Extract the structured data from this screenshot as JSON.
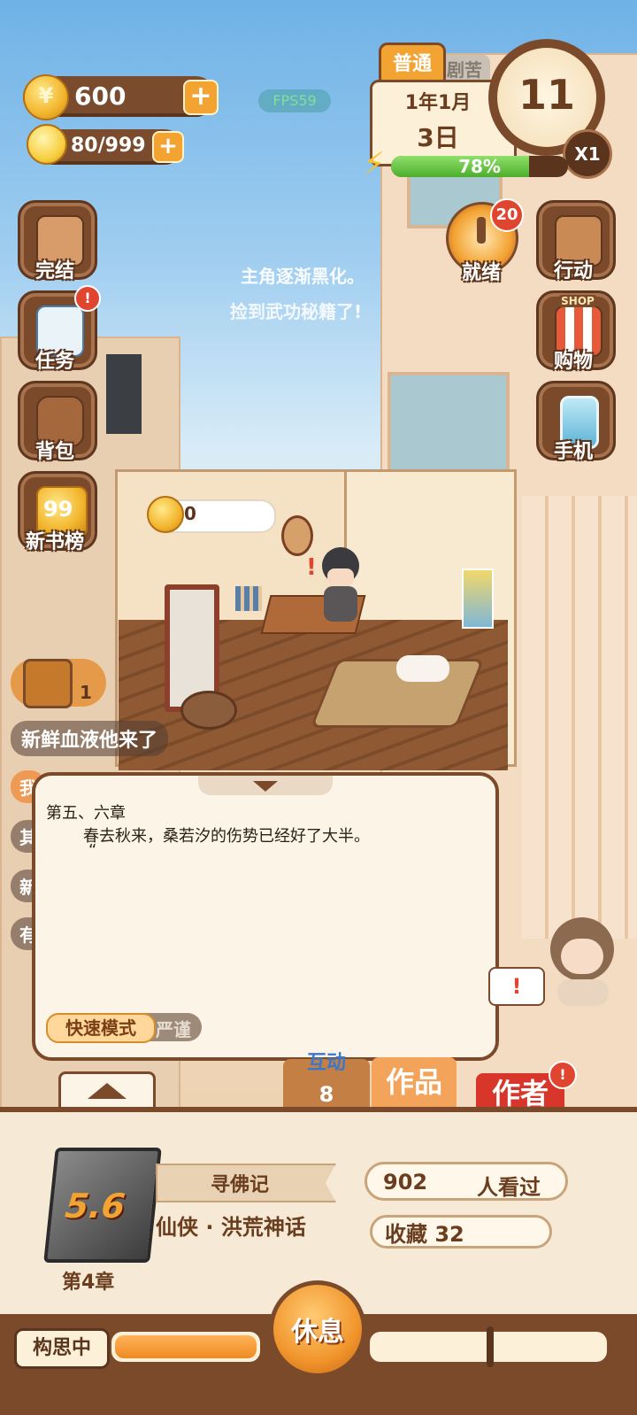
{
  "hud": {
    "coins": "600",
    "energy": "80/999",
    "fps": "FPS59",
    "difficulty": "普通",
    "difficulty_hidden": "剧苦",
    "date_line1": "1年1月",
    "date_line2": "3日",
    "clock_value": "11",
    "speed": "X1",
    "progress_label": "78%",
    "progress_value": 0.78
  },
  "side_menu_left": [
    {
      "label": "完结",
      "icon": "book-icon"
    },
    {
      "label": "任务",
      "icon": "checklist-icon"
    },
    {
      "label": "背包",
      "icon": "bag-icon"
    },
    {
      "label": "新书榜",
      "icon": "ranking-icon",
      "badge": "99"
    }
  ],
  "side_menu_right": [
    {
      "label": "就绪",
      "icon": "clock-dial-icon",
      "badge": "20"
    },
    {
      "label": "行动",
      "icon": "door-icon"
    },
    {
      "label": "购物",
      "icon": "shop-icon",
      "sign": "SHOP"
    },
    {
      "label": "手机",
      "icon": "phone-icon"
    }
  ],
  "floating_texts": [
    "主角逐渐黑化。",
    "捡到武功秘籍了!"
  ],
  "room": {
    "coin_bubble": "0"
  },
  "chest": {
    "count": "1"
  },
  "comments": [
    "新鲜血液他来了",
    "我",
    "其",
    "新",
    "有"
  ],
  "dialog": {
    "chapter": "第五、六章",
    "line1": "春去秋来，桑若汐的伤势已经好了大半。",
    "line2": "“",
    "mode_fast": "快速模式",
    "mode_strict": "严谨"
  },
  "tabs": {
    "interact": "互动",
    "interact_count": "8",
    "works": "作品",
    "author": "作者"
  },
  "book": {
    "score": "5.6",
    "title": "寻佛记",
    "genre": "仙侠 · 洪荒神话",
    "chapter": "第4章",
    "views_count": "902",
    "views_label": "人看过",
    "favorites": "收藏 32"
  },
  "bottom": {
    "status": "构思中",
    "rest_button": "休息"
  },
  "colors": {
    "brown": "#7b4a2b",
    "orange": "#f3a332",
    "green": "#5bbf3a",
    "red": "#e0452f"
  }
}
